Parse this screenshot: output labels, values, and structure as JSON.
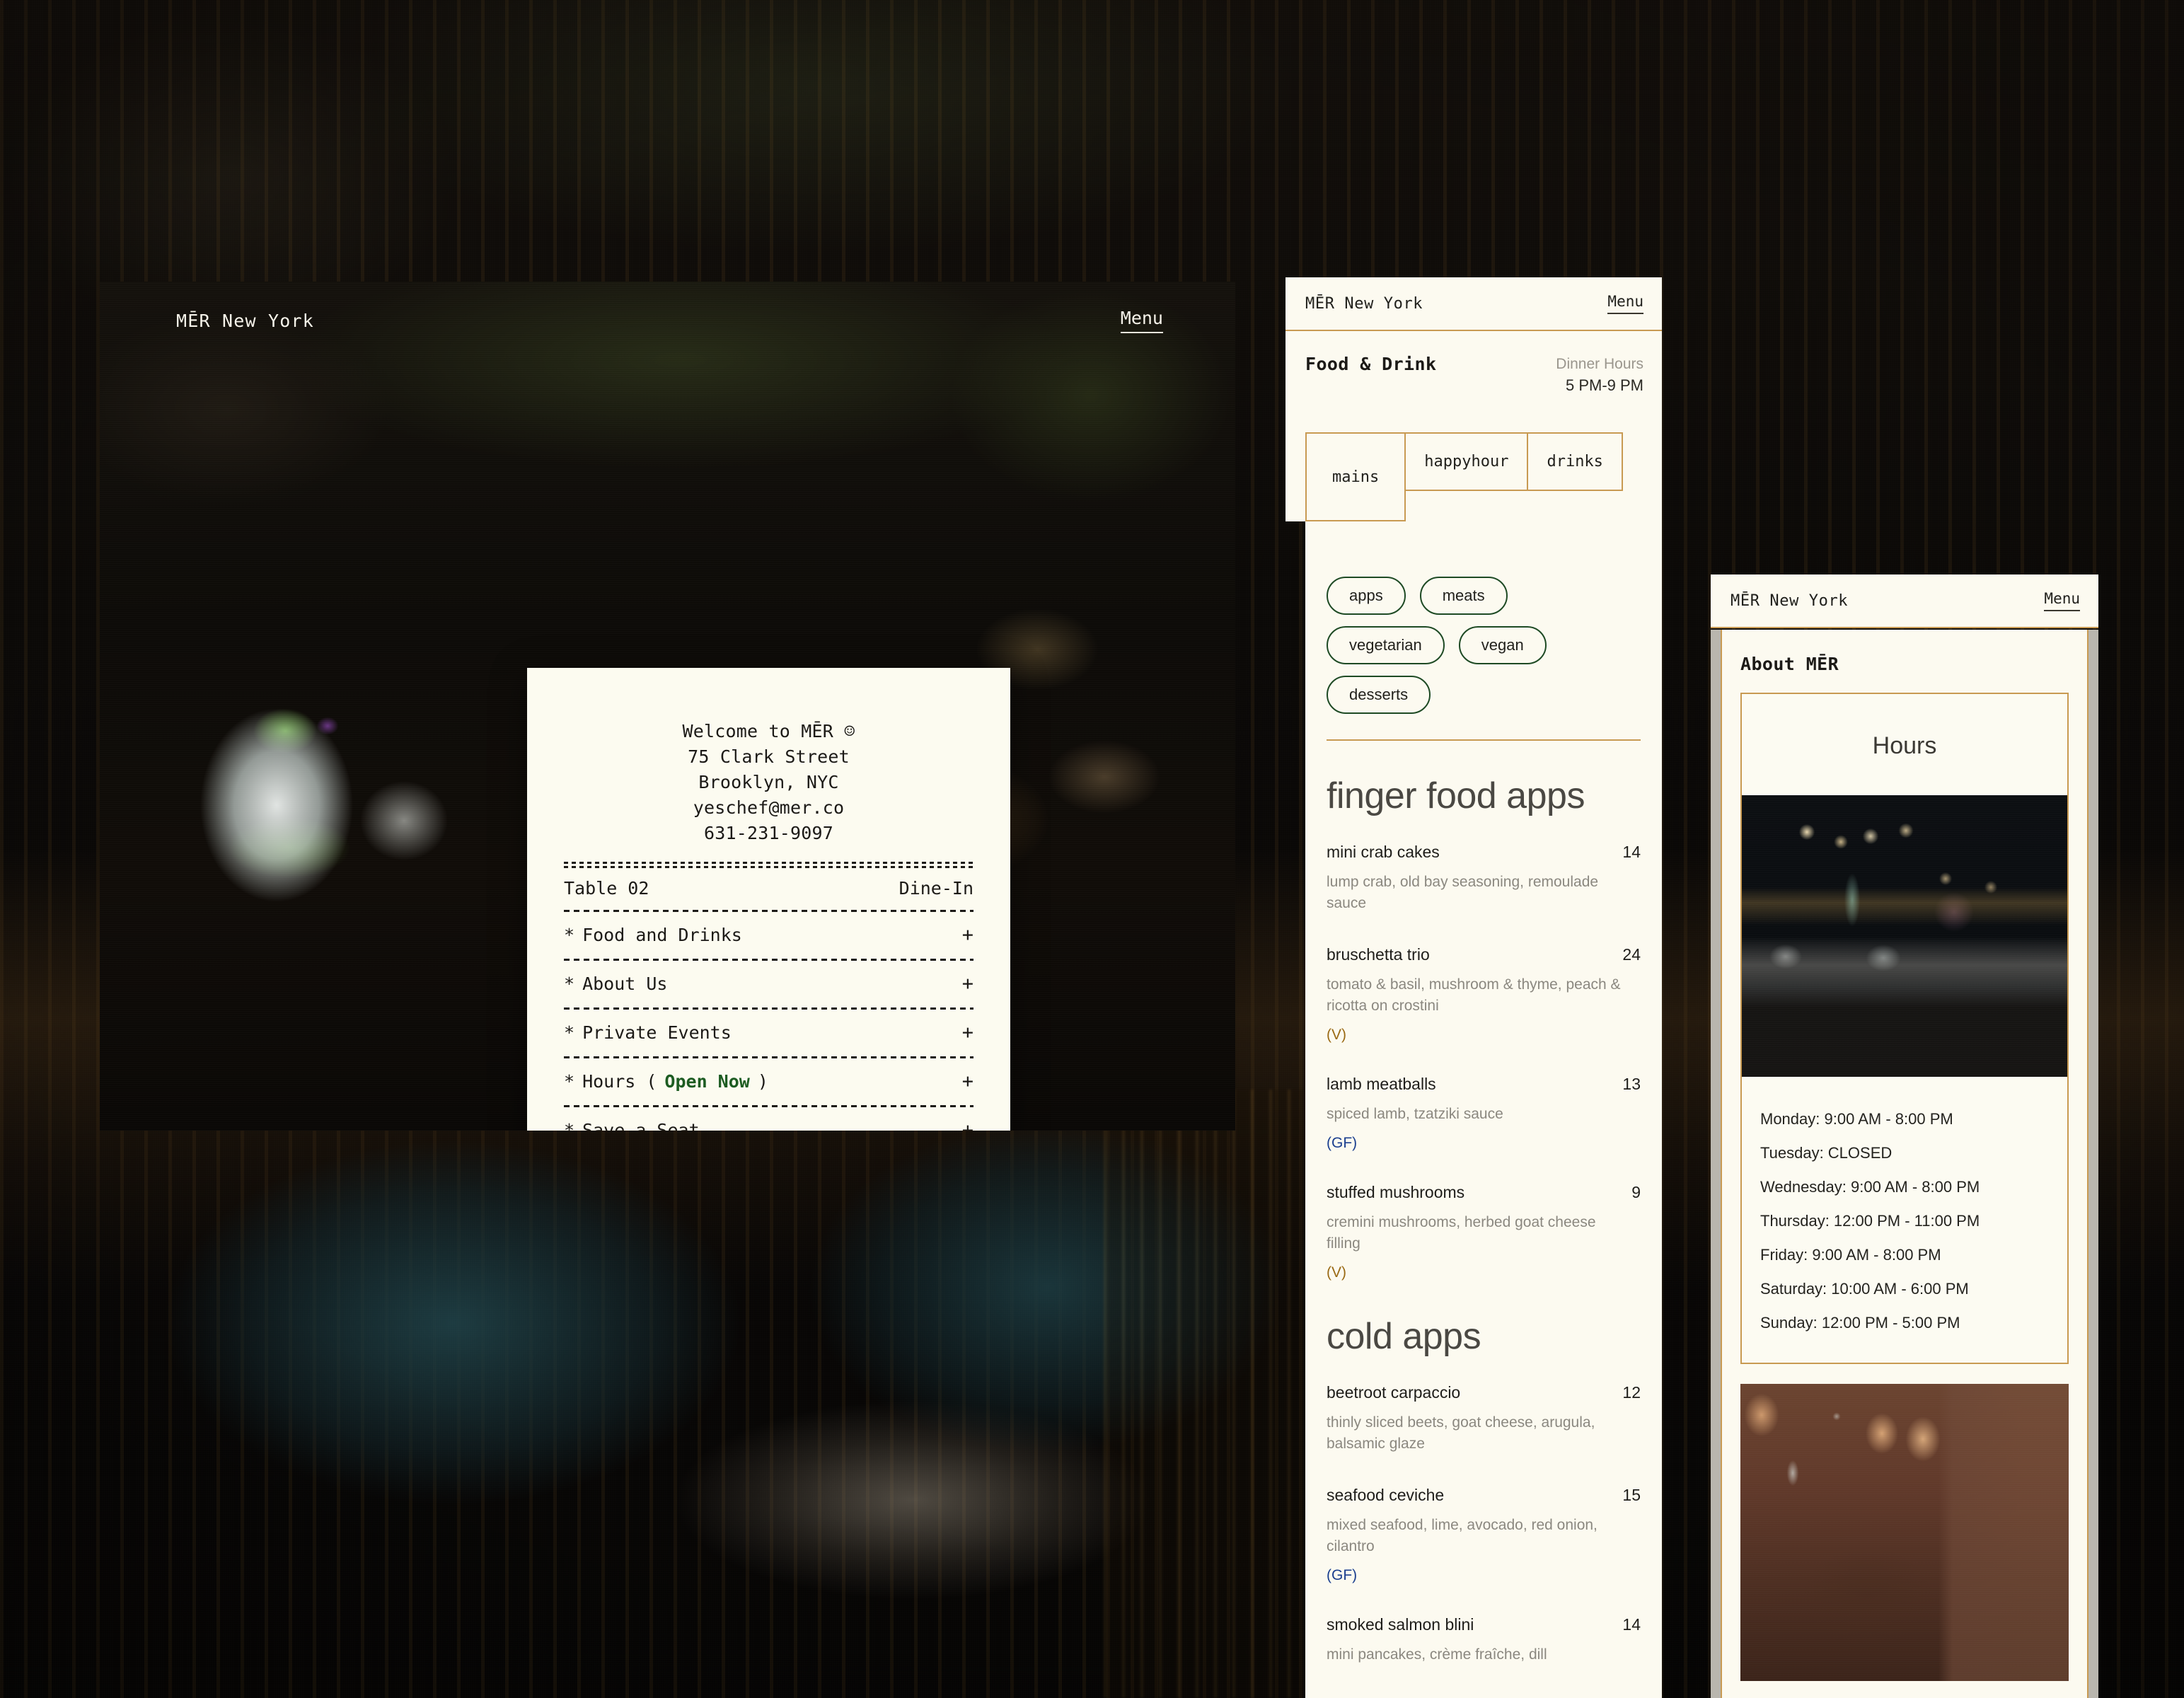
{
  "brand": "MĒR New York",
  "nav": {
    "menu_label": "Menu"
  },
  "hero": {
    "brand": "MĒR New York",
    "menu_label": "Menu",
    "photo_name": "dark-restaurant-table-with-margarita-photo"
  },
  "receipt": {
    "welcome": "Welcome to MĒR ☺",
    "address_line1": "75 Clark Street",
    "address_line2": "Brooklyn, NYC",
    "email": "yeschef@mer.co",
    "phone": "631-231-9097",
    "table_label": "Table 02",
    "service_type": "Dine-In",
    "items": [
      {
        "star": "*",
        "label": "Food and Drinks",
        "expand": "+"
      },
      {
        "star": "*",
        "label": "About Us",
        "expand": "+"
      },
      {
        "star": "*",
        "label": "Private Events",
        "expand": "+"
      },
      {
        "star": "*",
        "label": "Hours (",
        "status": "Open Now",
        "label_end": ")",
        "expand": "+"
      },
      {
        "star": "*",
        "label": "Save a Seat",
        "expand": "+"
      }
    ],
    "hours_prefix": "Hours (",
    "hours_status": "Open Now",
    "hours_suffix": ")"
  },
  "menu_panel": {
    "brand": "MĒR New York",
    "menu_label": "Menu",
    "title": "Food & Drink",
    "hours_label": "Dinner Hours",
    "hours_value": "5 PM-9 PM",
    "tabs": [
      {
        "label": "mains",
        "active": true
      },
      {
        "label": "happyhour",
        "active": false
      },
      {
        "label": "drinks",
        "active": false
      }
    ],
    "filters": [
      "apps",
      "meats",
      "vegetarian",
      "vegan",
      "desserts"
    ],
    "sections": [
      {
        "title": "finger food apps",
        "items": [
          {
            "name": "mini crab cakes",
            "price": "14",
            "desc": "lump crab, old bay seasoning, remoulade sauce",
            "tag": ""
          },
          {
            "name": "bruschetta trio",
            "price": "24",
            "desc": "tomato & basil, mushroom & thyme, peach & ricotta on crostini",
            "tag": "(V)"
          },
          {
            "name": "lamb meatballs",
            "price": "13",
            "desc": "spiced lamb, tzatziki sauce",
            "tag": "(GF)"
          },
          {
            "name": "stuffed mushrooms",
            "price": "9",
            "desc": "cremini mushrooms, herbed goat cheese filling",
            "tag": "(V)"
          }
        ]
      },
      {
        "title": "cold apps",
        "items": [
          {
            "name": "beetroot carpaccio",
            "price": "12",
            "desc": "thinly sliced beets, goat cheese, arugula, balsamic glaze",
            "tag": ""
          },
          {
            "name": "seafood ceviche",
            "price": "15",
            "desc": "mixed seafood, lime, avocado, red onion, cilantro",
            "tag": "(GF)"
          },
          {
            "name": "smoked salmon blini",
            "price": "14",
            "desc": "mini pancakes, crème fraîche, dill",
            "tag": ""
          }
        ]
      }
    ]
  },
  "about_panel": {
    "brand": "MĒR New York",
    "menu_label": "Menu",
    "title": "About MĒR",
    "hours_card_title": "Hours",
    "photo1_name": "bar-with-cocktail-glasses-photo",
    "photo2_name": "terracotta-dining-room-photo",
    "hours": [
      "Monday: 9:00 AM - 8:00 PM",
      "Tuesday: CLOSED",
      "Wednesday: 9:00 AM - 8:00 PM",
      "Thursday: 12:00 PM - 11:00 PM",
      "Friday: 9:00 AM - 8:00 PM",
      "Saturday: 10:00 AM - 6:00 PM",
      "Sunday: 12:00 PM - 5:00 PM"
    ]
  },
  "colors": {
    "paper": "#fcfaf0",
    "gold_border": "#c89a52",
    "green_pill": "#1e4a24",
    "open_now_green": "#1d5c22",
    "tag_v_gold": "#9a6a15",
    "tag_gf_blue": "#1b3f8f",
    "ink": "#1c1a17",
    "muted": "#8b8880"
  }
}
